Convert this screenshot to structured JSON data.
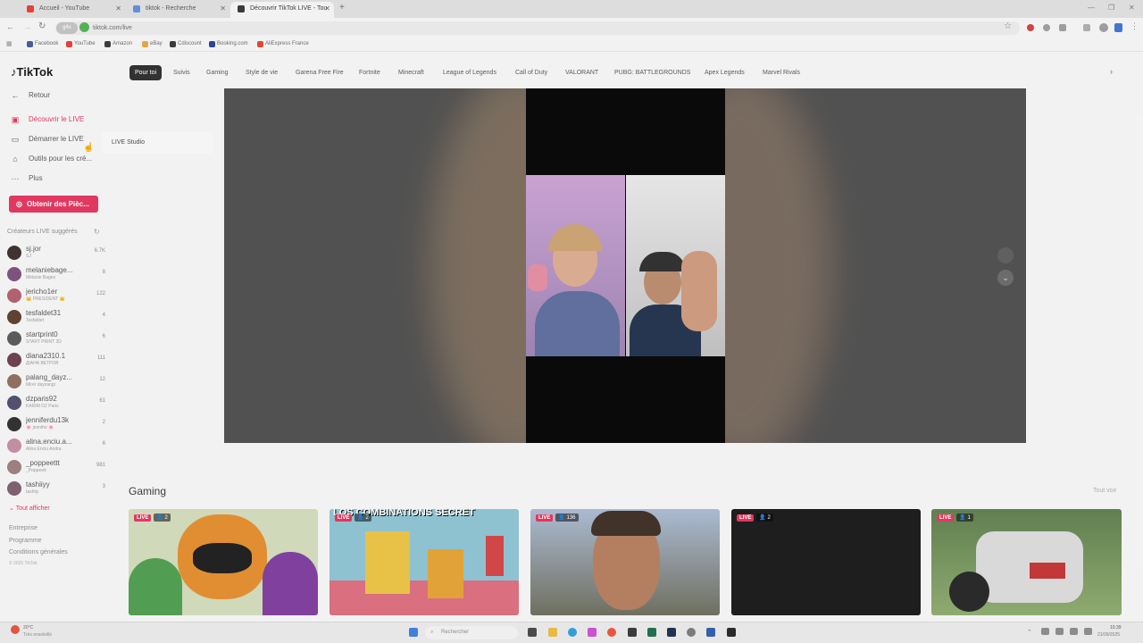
{
  "browser": {
    "tabs": [
      {
        "title": "Accueil - YouTube",
        "color": "#e53935"
      },
      {
        "title": "tiktok - Recherche",
        "color": "#5c8bd6"
      },
      {
        "title": "Découvrir TikTok LIVE - Tou",
        "color": "#333333"
      }
    ],
    "new_tab": "+",
    "url_badge": "g4x",
    "url": "tiktok.com/live",
    "bookmarks": [
      {
        "label": "Facebook",
        "color": "#3b5998"
      },
      {
        "label": "YouTube",
        "color": "#e53935"
      },
      {
        "label": "Amazon",
        "color": "#333333"
      },
      {
        "label": "eBay",
        "color": "#e8a33b"
      },
      {
        "label": "Cdiscount",
        "color": "#333333"
      },
      {
        "label": "Booking.com",
        "color": "#243f8e"
      },
      {
        "label": "AliExpress France",
        "color": "#e0402b"
      }
    ]
  },
  "brand": {
    "name": "TikTok",
    "accent": "#e0305a"
  },
  "sidebar": {
    "back": "Retour",
    "nav": [
      {
        "label": "Découvrir le LIVE",
        "icon": "live-icon",
        "active": true
      },
      {
        "label": "Démarrer le LIVE",
        "icon": "camera-icon"
      },
      {
        "label": "Outils pour les cré...",
        "icon": "home-icon"
      },
      {
        "label": "Plus",
        "icon": "more-icon"
      }
    ],
    "flyout": "LIVE Studio",
    "coins_button": "Obtenir des Pièc...",
    "suggested_title": "Créateurs LIVE suggérés",
    "creators": [
      {
        "name": "sj.jor",
        "sub": "SJ",
        "count": "6.7K",
        "color": "#3a2a2a"
      },
      {
        "name": "melaniebage...",
        "sub": "Mélanie Bages",
        "count": "8",
        "color": "#7a4a7a"
      },
      {
        "name": "jericho1er",
        "sub": "👑 PRESIDENT 👑",
        "count": "122",
        "color": "#b05a6a"
      },
      {
        "name": "tesfaldet31",
        "sub": "Tesfaldet",
        "count": "4",
        "color": "#5a3a2a"
      },
      {
        "name": "startprint0",
        "sub": "START PRINT 3D",
        "count": "6",
        "color": "#555555"
      },
      {
        "name": "diana2310.1",
        "sub": "ДІАНА ВЕТРОВ",
        "count": "111",
        "color": "#6a3a4a"
      },
      {
        "name": "palang_dayz...",
        "sub": "Mirer dayzangi",
        "count": "12",
        "color": "#8a6a5a"
      },
      {
        "name": "dzparis92",
        "sub": "KARIM DZ Paris",
        "count": "61",
        "color": "#4a4a6a"
      },
      {
        "name": "jenniferdu13k",
        "sub": "🌸 jennifer 🌸",
        "count": "2",
        "color": "#2a2a2a"
      },
      {
        "name": "alina.enciu.a...",
        "sub": "Alina Enciu Andra",
        "count": "6",
        "color": "#c08aa0"
      },
      {
        "name": "_poppeettt",
        "sub": "_Poppeett",
        "count": "981",
        "color": "#9a7a7a"
      },
      {
        "name": "tashiiyy",
        "sub": "tashiiy",
        "count": "3",
        "color": "#7a5a6a"
      }
    ],
    "see_all": "Tout afficher",
    "footer": [
      "Entreprise",
      "Programme",
      "Conditions générales",
      "© 2025 TikTok"
    ]
  },
  "categories": [
    "Pour toi",
    "Suivis",
    "Gaming",
    "Style de vie",
    "Garena Free Fire",
    "Fortnite",
    "Minecraft",
    "League of Legends",
    "Call of Duty",
    "VALORANT",
    "PUBG: BATTLEGROUNDS",
    "Apex Legends",
    "Marvel Rivals"
  ],
  "section": {
    "title": "Gaming",
    "see_all": "Tout voir"
  },
  "thumbs": [
    {
      "live": "LIVE",
      "viewers": "2"
    },
    {
      "live": "LIVE",
      "viewers": "2",
      "overlay_text": "LOS COMBINATIONS SECRET"
    },
    {
      "live": "LIVE",
      "viewers": "136"
    },
    {
      "live": "LIVE",
      "viewers": "2"
    },
    {
      "live": "LIVE",
      "viewers": "1"
    }
  ],
  "taskbar": {
    "weather_temp": "20°C",
    "weather_desc": "Très ensoleillé",
    "search_placeholder": "Rechercher",
    "time": "10:39",
    "date": "21/09/2025"
  }
}
